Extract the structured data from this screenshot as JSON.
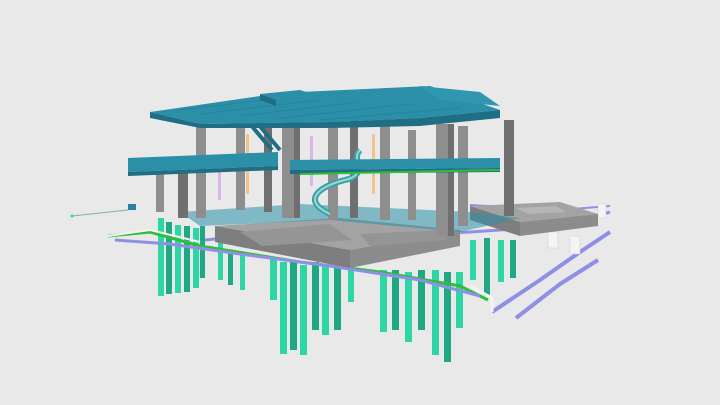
{
  "scene": {
    "kind": "3D BIM structural model viewport",
    "colors": {
      "background": "#e9e9e9",
      "piles": "#2ed6a6",
      "piles_dark": "#1fa884",
      "columns": "#8e8e8e",
      "columns_dark": "#6f6f6f",
      "slab_top": "#2b8fa8",
      "slab_side": "#1f6e83",
      "foundation": "#a3a3a3",
      "foundation_dark": "#7e7e7e",
      "pipe_green": "#2fbe3a",
      "pipe_blue": "#8f8fe6",
      "pipe_white": "#f4f4f4"
    }
  }
}
